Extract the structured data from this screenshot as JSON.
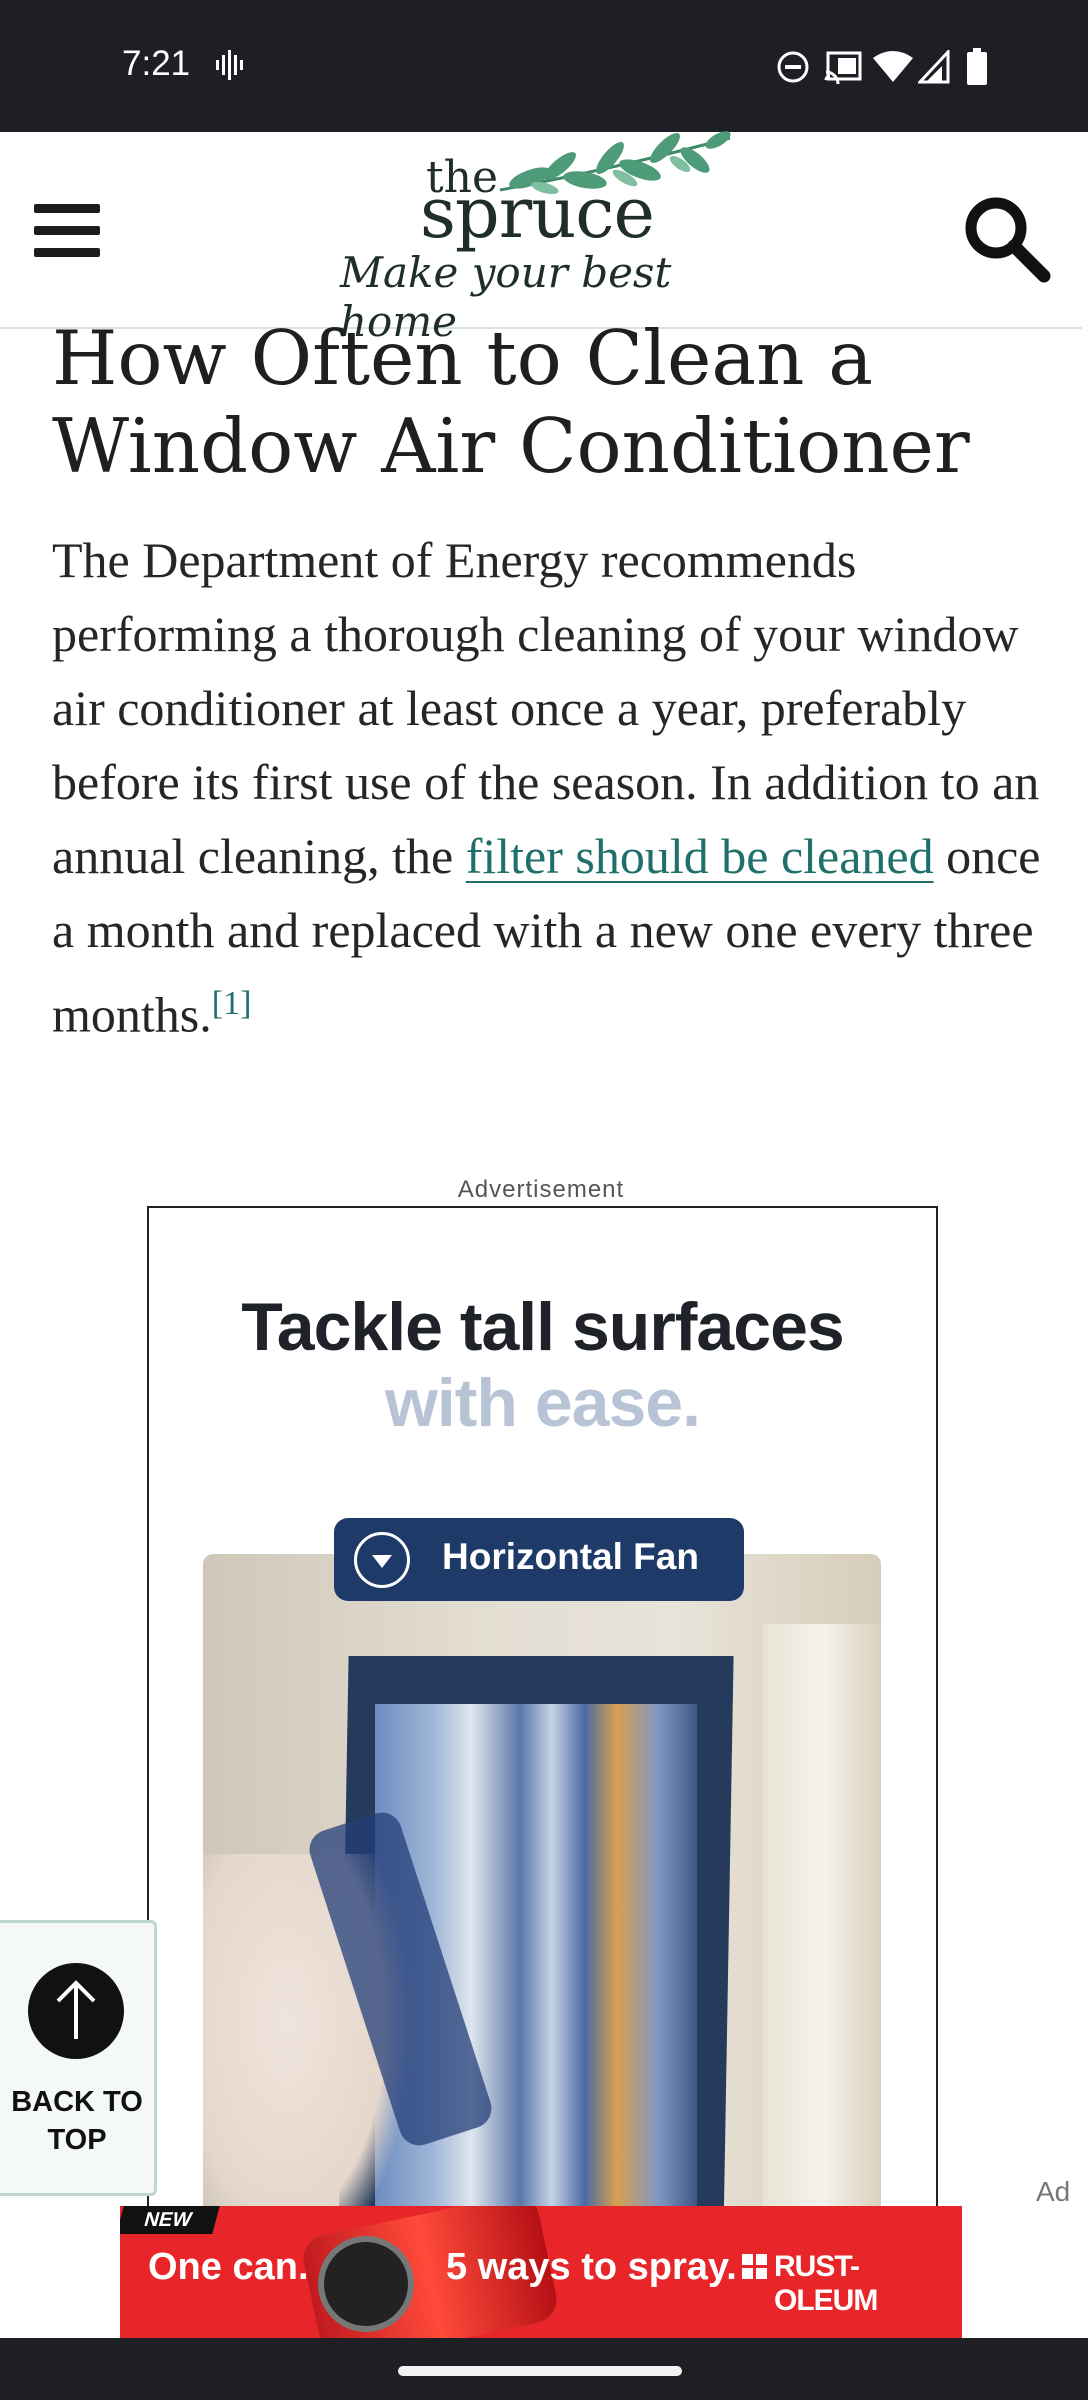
{
  "status_bar": {
    "time": "7:21",
    "icons": [
      "voice-activity-icon",
      "do-not-disturb-icon",
      "cast-icon",
      "wifi-icon",
      "cellular-signal-icon",
      "battery-icon"
    ]
  },
  "header": {
    "logo": {
      "line1": "the",
      "line2": "spruce",
      "tagline": "Make your best home"
    },
    "menu_icon": "hamburger-menu-icon",
    "search_icon": "search-icon"
  },
  "article": {
    "headline": "How Often to Clean a Window Air Conditioner",
    "body_before_link": "The Department of Energy recommends performing a thorough cleaning of your window air conditioner at least once a year, preferably before its first use of the season. In addition to an annual cleaning, the ",
    "link_text": "filter should be cleaned",
    "body_after_link": " once a month and replaced with a new one every three months.",
    "footnote": "[1]"
  },
  "advertisement": {
    "label": "Advertisement",
    "headline_line1": "Tackle tall surfaces",
    "headline_line2": "with ease.",
    "pill_label": "Horizontal Fan",
    "ad_choice": "Ad"
  },
  "back_to_top": {
    "label": "BACK TO TOP"
  },
  "banner_ad": {
    "badge": "NEW",
    "text1": "One can.",
    "text2": "5 ways to spray.",
    "brand": "RUST-OLEUM"
  },
  "colors": {
    "status_bar": "#1d1f24",
    "link": "#1f6f6a",
    "ad_pill": "#1e3a69",
    "banner": "#e8262a"
  }
}
